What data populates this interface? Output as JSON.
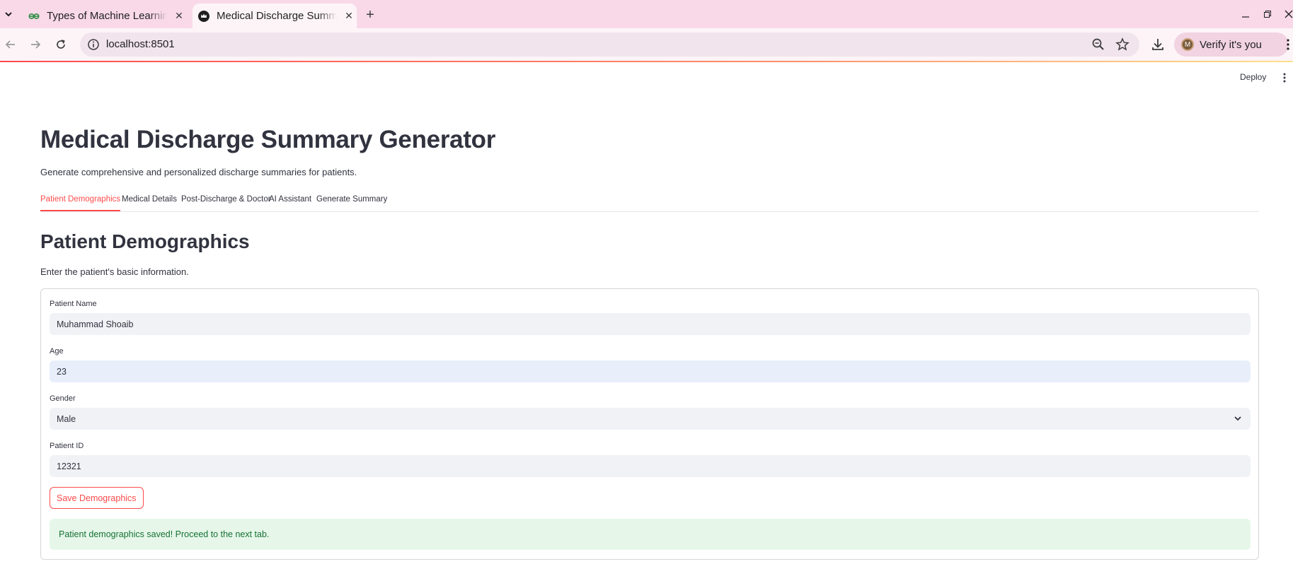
{
  "browser": {
    "tabs": [
      {
        "title": "Types of Machine Learning",
        "favicon": "gfg-icon"
      },
      {
        "title": "Medical Discharge Summary Generator",
        "favicon": "streamlit-crown-icon"
      }
    ],
    "url": "localhost:8501",
    "profile_button": "Verify it's you",
    "profile_initial": "M"
  },
  "app": {
    "deploy_label": "Deploy",
    "title": "Medical Discharge Summary Generator",
    "subtitle": "Generate comprehensive and personalized discharge summaries for patients.",
    "tabs": [
      {
        "label": "Patient Demographics",
        "active": true
      },
      {
        "label": "Medical Details",
        "active": false
      },
      {
        "label": "Post-Discharge & Doctor",
        "active": false
      },
      {
        "label": "AI Assistant",
        "active": false
      },
      {
        "label": "Generate Summary",
        "active": false
      }
    ],
    "section": {
      "heading": "Patient Demographics",
      "description": "Enter the patient's basic information.",
      "fields": {
        "name": {
          "label": "Patient Name",
          "value": "Muhammad Shoaib"
        },
        "age": {
          "label": "Age",
          "value": "23"
        },
        "gender": {
          "label": "Gender",
          "value": "Male"
        },
        "patient_id": {
          "label": "Patient ID",
          "value": "12321"
        }
      },
      "save_button": "Save Demographics",
      "success_message": "Patient demographics saved! Proceed to the next tab."
    }
  },
  "colors": {
    "accent": "#ff4b4b",
    "success_bg": "#e6f7ea",
    "success_text": "#177233",
    "tabbar_bg": "#f9d9e8"
  }
}
